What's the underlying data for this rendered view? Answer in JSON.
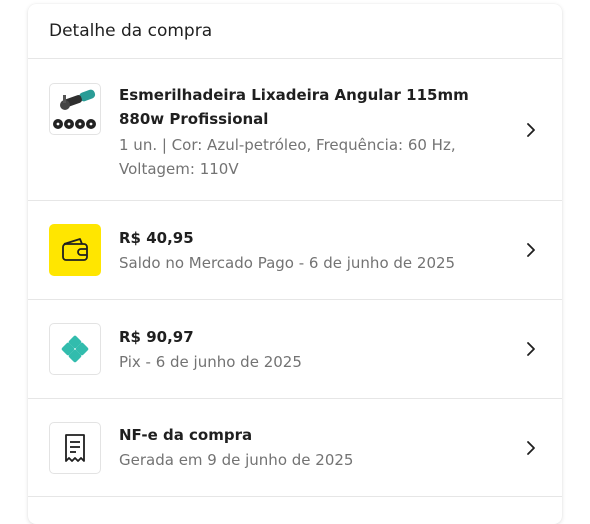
{
  "header": {
    "title": "Detalhe da compra"
  },
  "product": {
    "title": "Esmerilhadeira Lixadeira Angular 115mm 880w Profissional",
    "details": "1 un. | Cor: Azul-petróleo, Frequência: 60 Hz, Voltagem: 110V",
    "icon": "angle-grinder-product-image"
  },
  "payments": [
    {
      "amount": "R$ 40,95",
      "description": "Saldo no Mercado Pago - 6 de junho de 2025",
      "icon": "wallet-icon",
      "color": "#ffe600"
    },
    {
      "amount": "R$ 90,97",
      "description": "Pix - 6 de junho de 2025",
      "icon": "pix-icon",
      "color": "#32bcad"
    }
  ],
  "invoice": {
    "title": "NF-e da compra",
    "description": "Gerada em 9 de junho de 2025",
    "icon": "receipt-icon"
  }
}
